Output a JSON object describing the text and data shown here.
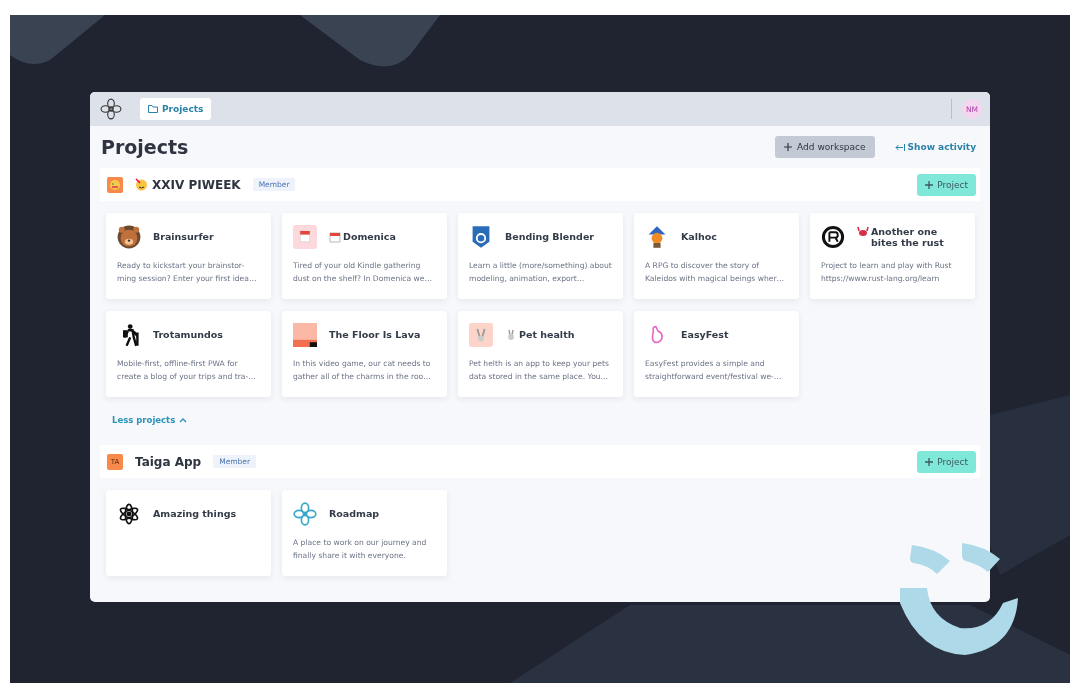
{
  "topbar": {
    "breadcrumb": "Projects",
    "avatar": "NM"
  },
  "page": {
    "title": "Projects",
    "add_workspace": "Add workspace",
    "show_activity": "Show activity"
  },
  "workspaces": [
    {
      "name": "XXIV PIWEEK",
      "badge": "Member",
      "new_project": "Project",
      "expanded": true,
      "toggle": "Less projects",
      "projects": [
        {
          "name": "Brainsurfer",
          "description": "Ready to kickstart your brainstor-ming session? Enter your first idea…"
        },
        {
          "name": "Domenica",
          "description": "Tired of your old Kindle gathering dust on the shelf? In Domenica we…"
        },
        {
          "name": "Bending Blender",
          "description": "Learn a little (more/something) about modeling, animation, export…"
        },
        {
          "name": "Kalhoc",
          "description": "A RPG to discover the story of Kaleidos with magical beings wher…"
        },
        {
          "name": "Another one bites the rust",
          "description": "Project to learn and play with Rust https://www.rust-lang.org/learn"
        },
        {
          "name": "Trotamundos",
          "description": "Mobile-first, offline-first PWA for create a blog of your trips and tra-…"
        },
        {
          "name": "The Floor Is Lava",
          "description": "In this video game, our cat needs to gather all of the charms in the roo…"
        },
        {
          "name": "Pet health",
          "description": "Pet helth is an app to keep your pets data stored in the same place. You…"
        },
        {
          "name": "EasyFest",
          "description": "EasyFest provides a simple and straightforward event/festival we-…"
        }
      ]
    },
    {
      "name": "Taiga App",
      "badge": "Member",
      "avatar": {
        "kind": "initials",
        "text": "TA"
      },
      "new_project": "Project",
      "projects": [
        {
          "name": "Amazing things"
        },
        {
          "name": "Roadmap",
          "description": "A place to work on our journey and finally share it with everyone."
        }
      ]
    }
  ]
}
